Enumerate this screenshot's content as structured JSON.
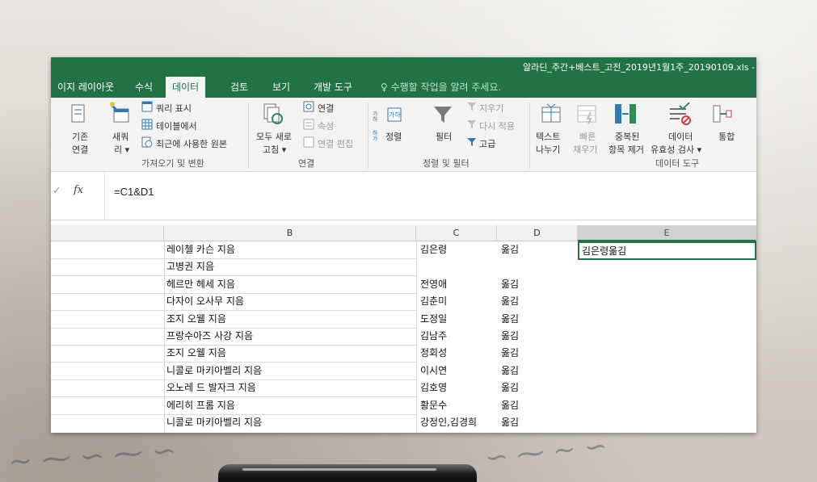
{
  "window": {
    "title": "알라딘_주간+베스트_고전_2019년1월1주_20190109.xls -"
  },
  "tabs": [
    {
      "label": "이지 레이아웃"
    },
    {
      "label": "수식"
    },
    {
      "label": "데이터"
    },
    {
      "label": "검토"
    },
    {
      "label": "보기"
    },
    {
      "label": "개발 도구"
    }
  ],
  "tell_me": "♀ 수행할 작업을 알려 주세요.",
  "ribbon": {
    "get_transform": {
      "existing_conn_top": "기존",
      "existing_conn_bottom": "연결",
      "new_query_top": "새쿼",
      "new_query_bottom": "리 ▾",
      "show_queries": "쿼리 표시",
      "from_table": "테이블에서",
      "recent_sources": "최근에 사용한 원본",
      "group": "가져오기 및 변환"
    },
    "connections": {
      "refresh_top": "모두 새로",
      "refresh_bottom": "고침 ▾",
      "connections": "연결",
      "properties": "속성",
      "edit_links": "연결 편집",
      "group": "연결"
    },
    "sort_filter": {
      "sort": "정렬",
      "filter": "필터",
      "clear": "지우기",
      "reapply": "다시 적용",
      "advanced": "고급",
      "group": "정렬 및 필터"
    },
    "data_tools": {
      "text_to_cols_top": "텍스트",
      "text_to_cols_bottom": "나누기",
      "flash_fill": "빠른",
      "flash_fill_bottom": "채우기",
      "remove_dup_top": "중복된",
      "remove_dup_bottom": "항목 제거",
      "validation_top": "데이터",
      "validation_bottom": "유효성 검사 ▾",
      "consolidate": "통합",
      "group": "데이터 도구"
    }
  },
  "formula_bar": {
    "fx": "fx",
    "formula": "=C1&D1"
  },
  "columns": [
    "B",
    "C",
    "D",
    "E"
  ],
  "rows": [
    {
      "b": "레이첼 카슨 지음",
      "c": "김은령",
      "d": "옮김",
      "e": "김은령옮김"
    },
    {
      "b": "고병권 지음",
      "c": "",
      "d": "",
      "e": ""
    },
    {
      "b": "헤르만 헤세 지음",
      "c": "전영애",
      "d": "옮김",
      "e": ""
    },
    {
      "b": "다자이 오사무 지음",
      "c": "김춘미",
      "d": "옮김",
      "e": ""
    },
    {
      "b": "조지 오웰 지음",
      "c": "도정일",
      "d": "옮김",
      "e": ""
    },
    {
      "b": "프랑수아즈 사강 지음",
      "c": "김남주",
      "d": "옮김",
      "e": ""
    },
    {
      "b": "조지 오웰 지음",
      "c": "정회성",
      "d": "옮김",
      "e": ""
    },
    {
      "b": "니콜로 마키아벨리 지음",
      "c": "이시연",
      "d": "옮김",
      "e": ""
    },
    {
      "b": "오노레 드 발자크 지음",
      "c": "김호영",
      "d": "옮김",
      "e": ""
    },
    {
      "b": "에리히 프롬 지음",
      "c": "황문수",
      "d": "옮김",
      "e": ""
    },
    {
      "b": "니콜로 마키아벨리 지음",
      "c": "강정인,김경희",
      "d": "옮김",
      "e": ""
    }
  ],
  "colors": {
    "excel_green": "#217346",
    "ribbon_bg": "#f3f3f3"
  }
}
